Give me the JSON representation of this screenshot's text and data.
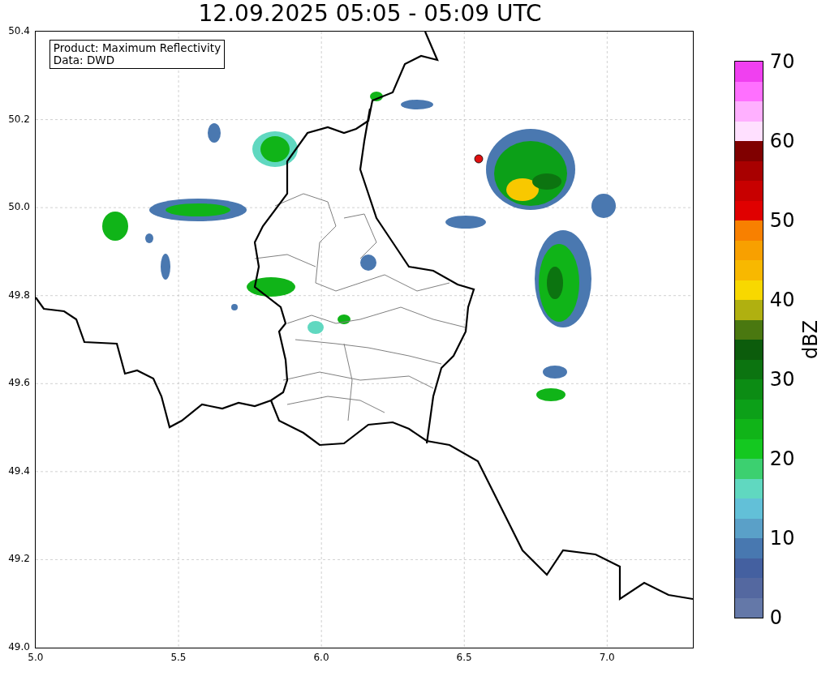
{
  "title": "12.09.2025 05:05 - 05:09 UTC",
  "info_box": {
    "lines": [
      "Product: Maximum Reflectivity",
      "Data: DWD"
    ]
  },
  "y_ticks": [
    "50.4",
    "50.2",
    "50.0",
    "49.8",
    "49.6",
    "49.4",
    "49.2",
    "49.0"
  ],
  "x_ticks": [
    "5.0",
    "5.5",
    "6.0",
    "6.5",
    "7.0"
  ],
  "colorbar": {
    "label": "dBZ",
    "ticks": [
      "70",
      "60",
      "50",
      "40",
      "30",
      "20",
      "10",
      "0"
    ],
    "segments": [
      {
        "color": "#6478a8"
      },
      {
        "color": "#5468a0"
      },
      {
        "color": "#4460a0"
      },
      {
        "color": "#4878b0"
      },
      {
        "color": "#5aa0c8"
      },
      {
        "color": "#62c0d8"
      },
      {
        "color": "#60d8c0"
      },
      {
        "color": "#3cd070"
      },
      {
        "color": "#14c820"
      },
      {
        "color": "#10b418"
      },
      {
        "color": "#0ca018"
      },
      {
        "color": "#0c8c14"
      },
      {
        "color": "#0c7410"
      },
      {
        "color": "#0c5c0c"
      },
      {
        "color": "#4a7810"
      },
      {
        "color": "#b0b010"
      },
      {
        "color": "#f8d800"
      },
      {
        "color": "#f8b800"
      },
      {
        "color": "#f8a000"
      },
      {
        "color": "#f88000"
      },
      {
        "color": "#e00000"
      },
      {
        "color": "#c80000"
      },
      {
        "color": "#a80000"
      },
      {
        "color": "#800000"
      },
      {
        "color": "#ffe0ff"
      },
      {
        "color": "#ffb0ff"
      },
      {
        "color": "#ff70ff"
      },
      {
        "color": "#f040f0"
      }
    ]
  }
}
